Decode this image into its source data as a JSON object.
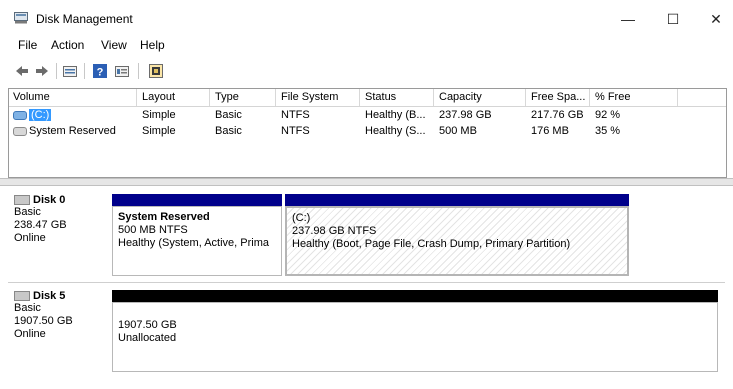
{
  "window": {
    "title": "Disk Management",
    "minimize": "—",
    "maximize": "☐",
    "close": "✕"
  },
  "menu": [
    "File",
    "Action",
    "View",
    "Help"
  ],
  "toolbar": [
    "back-icon",
    "forward-icon",
    "disk-list-icon",
    "help-icon",
    "properties-icon",
    "settings-icon"
  ],
  "columns": [
    "Volume",
    "Layout",
    "Type",
    "File System",
    "Status",
    "Capacity",
    "Free Spa...",
    "% Free"
  ],
  "volumes": [
    {
      "name": "(C:)",
      "layout": "Simple",
      "type": "Basic",
      "fs": "NTFS",
      "status": "Healthy (B...",
      "capacity": "237.98 GB",
      "free": "217.76 GB",
      "pct": "92 %"
    },
    {
      "name": "System Reserved",
      "layout": "Simple",
      "type": "Basic",
      "fs": "NTFS",
      "status": "Healthy (S...",
      "capacity": "500 MB",
      "free": "176 MB",
      "pct": "35 %"
    }
  ],
  "disks": [
    {
      "name": "Disk 0",
      "kind": "Basic",
      "size": "238.47 GB",
      "state": "Online",
      "partitions": [
        {
          "title": "System Reserved",
          "size": "500 MB NTFS",
          "status": "Healthy (System, Active, Prima"
        },
        {
          "title": "(C:)",
          "size": "237.98 GB NTFS",
          "status": "Healthy (Boot, Page File, Crash Dump, Primary Partition)"
        }
      ]
    },
    {
      "name": "Disk 5",
      "kind": "Basic",
      "size": "1907.50 GB",
      "state": "Online",
      "partitions": [
        {
          "size": "1907.50 GB",
          "status": "Unallocated"
        }
      ]
    }
  ],
  "colors": {
    "primary_bar": "#00008b",
    "unallocated_bar": "#000000",
    "selection": "#3399ff"
  }
}
